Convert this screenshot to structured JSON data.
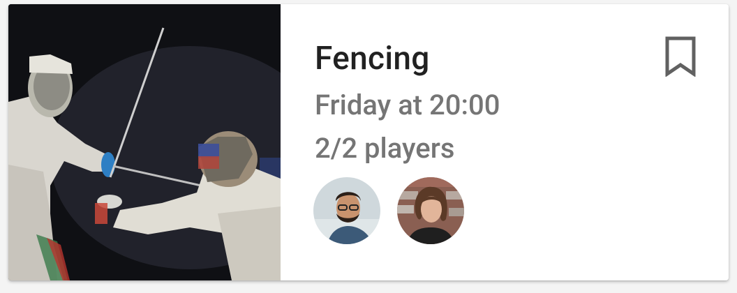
{
  "event": {
    "title": "Fencing",
    "when": "Friday at 20:00",
    "players": "2/2 players"
  },
  "colors": {
    "title": "#212121",
    "secondary": "#757575",
    "bookmark": "#616161"
  },
  "icons": {
    "bookmark": "bookmark-outline-icon"
  }
}
